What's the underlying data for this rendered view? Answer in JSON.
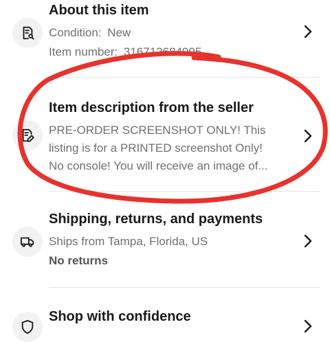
{
  "about": {
    "title": "About this item",
    "condition_label": "Condition:",
    "condition_value": "New",
    "item_number_label": "Item number:",
    "item_number_value": "316712684995"
  },
  "description": {
    "title": "Item description from the seller",
    "line1": "PRE-ORDER SCREENSHOT ONLY! This",
    "line2": "listing is for a PRINTED screenshot Only!",
    "line3": "No console! You will receive an image of..."
  },
  "shipping": {
    "title": "Shipping, returns, and payments",
    "ships_from": "Ships from Tampa, Florida, US",
    "returns": "No returns"
  },
  "confidence": {
    "title": "Shop with confidence"
  },
  "colors": {
    "annotation_red": "#e8322d",
    "text_primary": "#191919",
    "text_secondary": "#707070"
  },
  "icons": {
    "about": "document-search-icon",
    "description": "document-edit-icon",
    "shipping": "truck-icon",
    "confidence": "shield-icon",
    "chevron": "chevron-right-icon"
  }
}
